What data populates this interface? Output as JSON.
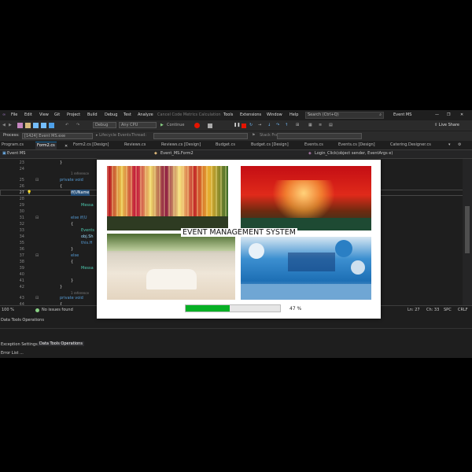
{
  "ide": {
    "menu": [
      "File",
      "Edit",
      "View",
      "Git",
      "Project",
      "Build",
      "Debug",
      "Test",
      "Analyze",
      "Cancel Code Metrics Calculation",
      "Tools",
      "Extensions",
      "Window",
      "Help"
    ],
    "search_placeholder": "Search (Ctrl+Q)",
    "solution_name": "Event MS",
    "live_share": "Live Share",
    "toolbar": {
      "config": "Debug",
      "platform": "Any CPU",
      "continue": "Continue"
    },
    "process_label": "Process:",
    "process_value": "[1424] Event MS.exe",
    "lifecycle": "Lifecycle Events",
    "thread_label": "Thread:",
    "stack_frame_label": "Stack Frame:",
    "tabs": [
      "Program.cs",
      "Form2.cs",
      "Form2.cs [Design]",
      "Reviews.cs",
      "Reviews.cs [Design]",
      "Budget.cs",
      "Budget.cs [Design]",
      "Events.cs",
      "Events.cs [Design]",
      "Catering.Designer.cs"
    ],
    "active_tab": "Form2.cs",
    "nav": {
      "project": "Event MS",
      "class": "Event_MS.Form2",
      "member": "Login_Click(object sender, EventArgs e)"
    },
    "line_numbers": [
      "23",
      "24",
      "25",
      "26",
      "27",
      "28",
      "29",
      "30",
      "31",
      "32",
      "33",
      "34",
      "35",
      "36",
      "37",
      "38",
      "39",
      "40",
      "41",
      "42",
      "43",
      "44"
    ],
    "current_line": "27",
    "code": {
      "brace_open": "{",
      "ref1": "1 reference",
      "private_void": "private void",
      "if_uname": "if(UName",
      "message1": "Messa",
      "else_if": "else if(U",
      "events": "Events",
      "obj": "obj.Sh",
      "this": "this.H",
      "else": "else",
      "message2": "Messa",
      "brace_close": "}",
      "ref2": "1 reference",
      "private_void2": "private void"
    },
    "status": {
      "zoom": "100 %",
      "issues": "No issues found",
      "ln": "Ln: 27",
      "ch": "Ch: 33",
      "spc": "SPC",
      "crlf": "CRLF"
    },
    "panel_title": "Data Tools Operations",
    "panel_tabs": [
      "Exception Settings",
      "Data Tools Operations"
    ],
    "error_list": "Error List ..."
  },
  "splash": {
    "title": "EVENT MANAGEMENT SYSTEM",
    "progress_percent": 47,
    "progress_label": "47 %"
  },
  "colors": {
    "accent": "#0e639c",
    "progress_fill": "#06b025",
    "breakpoint": "#e51400"
  }
}
